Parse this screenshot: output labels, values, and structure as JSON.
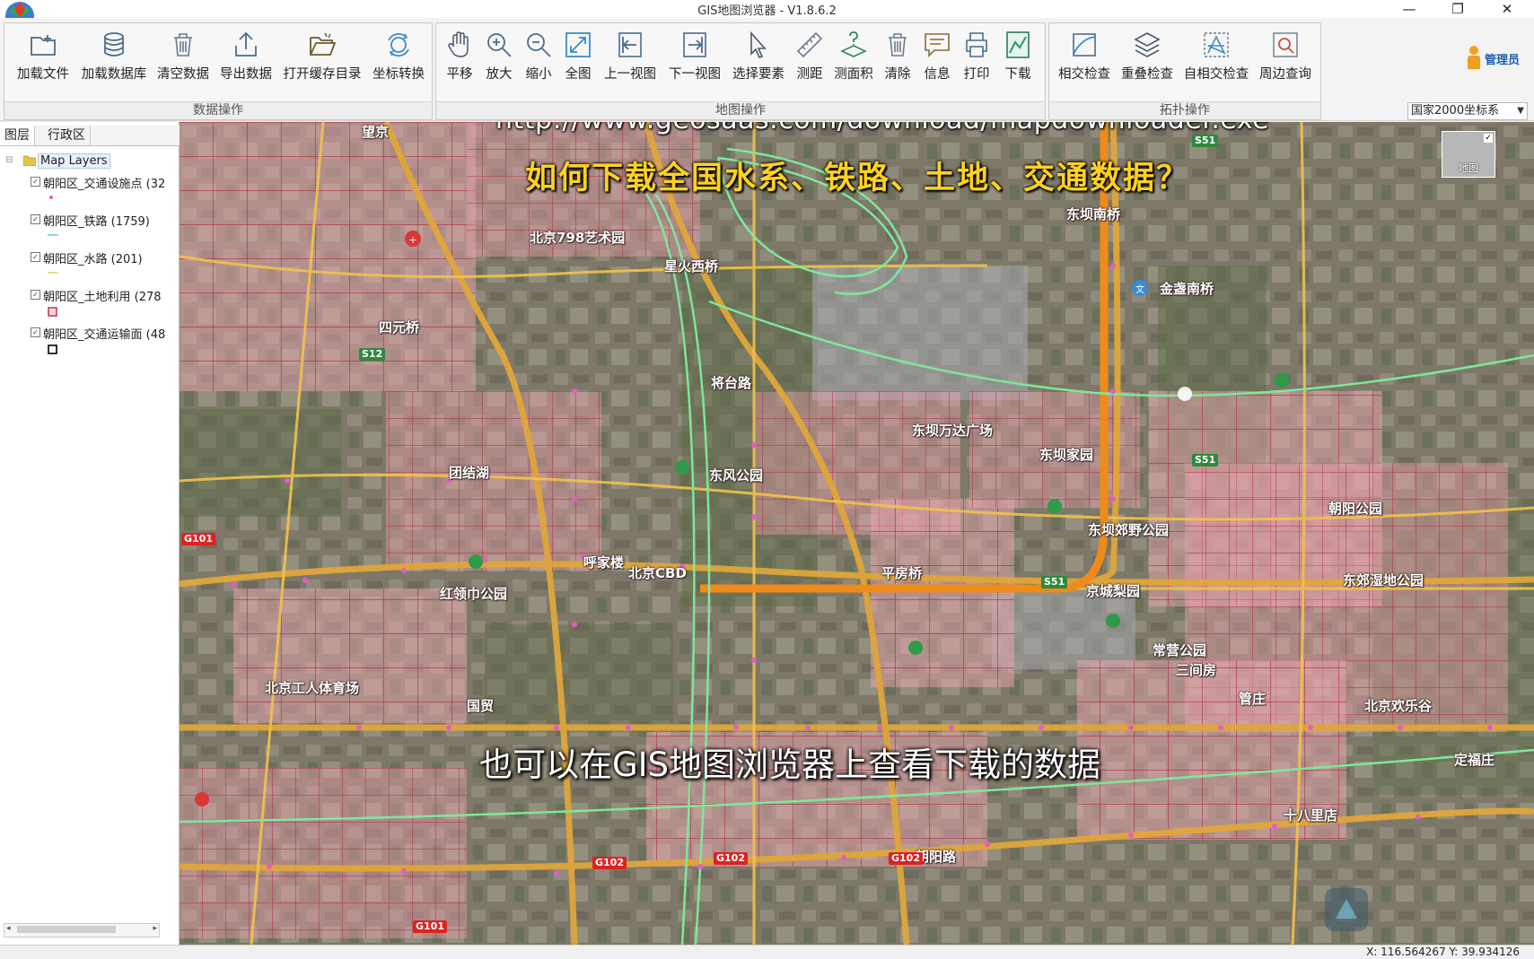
{
  "window": {
    "title": "GIS地图浏览器 - V1.8.6.2",
    "minimize": "—",
    "maximize": "❐",
    "close": "✕"
  },
  "user": {
    "label": "管理员"
  },
  "ribbon": {
    "groups": [
      {
        "label": "数据操作",
        "tools": [
          "加载文件",
          "加载数据库",
          "清空数据",
          "导出数据",
          "打开缓存目录",
          "坐标转换"
        ]
      },
      {
        "label": "地图操作",
        "tools": [
          "平移",
          "放大",
          "缩小",
          "全图",
          "上一视图",
          "下一视图",
          "选择要素",
          "测距",
          "测面积",
          "清除",
          "信息",
          "打印",
          "下载"
        ]
      },
      {
        "label": "拓扑操作",
        "tools": [
          "相交检查",
          "重叠检查",
          "自相交检查",
          "周边查询"
        ]
      }
    ],
    "crs": "国家2000坐标系"
  },
  "panel": {
    "tabs": [
      "图层",
      "行政区"
    ],
    "root": "Map Layers",
    "layers": [
      {
        "name": "朝阳区_交通设施点 (32",
        "symbol": "point"
      },
      {
        "name": "朝阳区_铁路 (1759)",
        "symbol": "line-green"
      },
      {
        "name": "朝阳区_水路 (201)",
        "symbol": "line-yellow"
      },
      {
        "name": "朝阳区_土地利用 (278",
        "symbol": "poly-red"
      },
      {
        "name": "朝阳区_交通运输面 (48",
        "symbol": "poly-black"
      }
    ]
  },
  "map": {
    "url_text": "http://www.geosaas.com/download/mapdownloader.exe",
    "title_text": "如何下载全国水系、铁路、土地、交通数据？",
    "caption": "也可以在GIS地图浏览器上查看下载的数据",
    "thumb_label": "地图",
    "places": [
      "望京",
      "朝阳公园",
      "北京798艺术园",
      "呼家楼",
      "四元桥",
      "东坝南桥",
      "东坝万达广场",
      "东风公园",
      "北京CBD",
      "平房桥",
      "东坝郊野公园",
      "京城梨园",
      "北京工人体育场",
      "朝阳路",
      "北京欢乐谷",
      "管庄",
      "常营公园",
      "十八里店",
      "团结湖",
      "东坝家园",
      "将台路",
      "红领巾公园",
      "东郊湿地公园",
      "定福庄",
      "星火西桥",
      "金盏南桥",
      "三间房",
      "国贸"
    ],
    "shields": [
      "S12",
      "S51",
      "S51",
      "S51",
      "G102",
      "G102",
      "G102",
      "G101",
      "G101"
    ]
  },
  "status": {
    "coords": "X: 116.564267   Y: 39.934126"
  }
}
